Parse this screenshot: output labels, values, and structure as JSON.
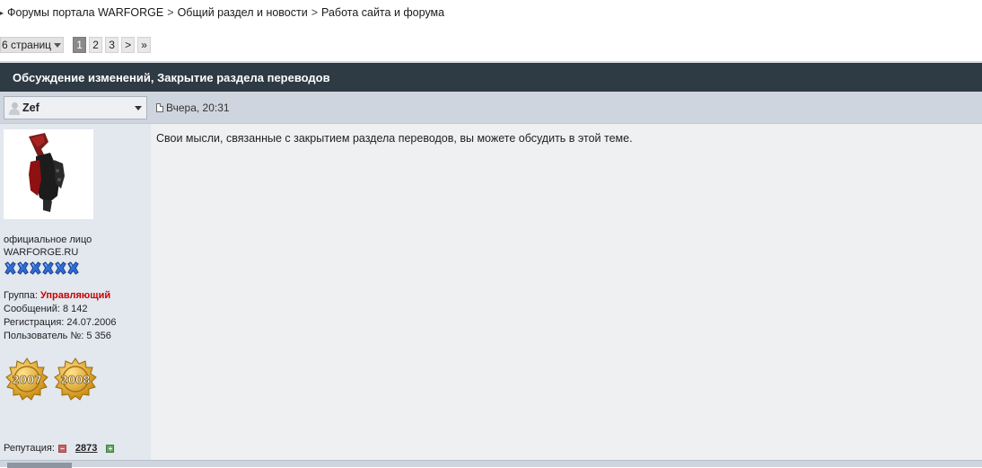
{
  "breadcrumb": {
    "items": [
      "Форумы портала WARFORGE",
      "Общий раздел и новости",
      "Работа сайта и форума"
    ],
    "separator": ">"
  },
  "pagination": {
    "pages_label": "6 страниц",
    "pages": [
      "1",
      "2",
      "3"
    ],
    "active_page": "1",
    "next": ">",
    "last": "»"
  },
  "topic": {
    "title": "Обсуждение изменений, Закрытие раздела переводов"
  },
  "post": {
    "author": "Zef",
    "date": "Вчера, 20:31",
    "text": "Свои мысли, связанные с закрытием раздела переводов, вы можете обсудить в этой теме."
  },
  "profile": {
    "title_line1": "официальное лицо",
    "title_line2": "WARFORGE.RU",
    "stars_count": 6,
    "group_label": "Группа:",
    "group_value": "Управляющий",
    "messages": "Сообщений: 8 142",
    "registration": "Регистрация: 24.07.2006",
    "user_no": "Пользователь №: 5 356",
    "medals": [
      "2007",
      "2008"
    ],
    "reputation_label": "Репутация:",
    "reputation_value": "2873"
  },
  "colors": {
    "topic_bar": "#2e3a44",
    "group_red": "#cc0000",
    "medal_gold": "#e6a91e",
    "star_blue": "#2f6fd6"
  }
}
